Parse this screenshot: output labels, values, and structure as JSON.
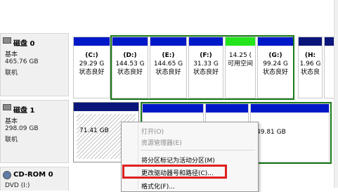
{
  "disks": [
    {
      "name": "磁盘 0",
      "type": "基本",
      "size": "465.76 GB",
      "status": "联机",
      "partitions": [
        {
          "label": "(C:)",
          "size": "29.29 G",
          "status": "状态良好"
        },
        {
          "label": "(D:)",
          "size": "144.53 G",
          "status": "状态良好"
        },
        {
          "label": "(E:)",
          "size": "144.65 G",
          "status": "状态良好"
        },
        {
          "label": "(F:)",
          "size": "31.33 G",
          "status": "状态良好"
        },
        {
          "label": "",
          "size": "14.25 (",
          "status": "可用空间"
        },
        {
          "label": "(G:)",
          "size": "99.24 G",
          "status": "状态良好"
        },
        {
          "label": "(H:",
          "size": "1.96 G",
          "status": "状态良"
        }
      ]
    },
    {
      "name": "磁盘 1",
      "type": "基本",
      "size": "298.09 GB",
      "status": "联机",
      "partitions": [
        {
          "label": "",
          "size": "71.41 GB",
          "status": ""
        },
        {
          "label": "",
          "size": "49.81 GB",
          "status": ""
        }
      ]
    },
    {
      "name": "CD-ROM 0",
      "type": "DVD (I:)"
    }
  ],
  "context_menu": {
    "items": [
      {
        "label": "打开(O)",
        "enabled": false
      },
      {
        "label": "资源管理器(E)",
        "enabled": false
      },
      {
        "label": "将分区标记为活动分区(M)",
        "enabled": true
      },
      {
        "label": "更改驱动器号和路径(C)...",
        "enabled": true,
        "highlighted": true
      },
      {
        "label": "格式化(F)...",
        "enabled": true
      }
    ]
  },
  "colors": {
    "primary_partition_bar": "#0019c8",
    "free_space_bar": "#24e41c",
    "unallocated_bar": "#0a167a",
    "selection_frame": "#1a7a1a",
    "highlight_box": "#e02020"
  }
}
